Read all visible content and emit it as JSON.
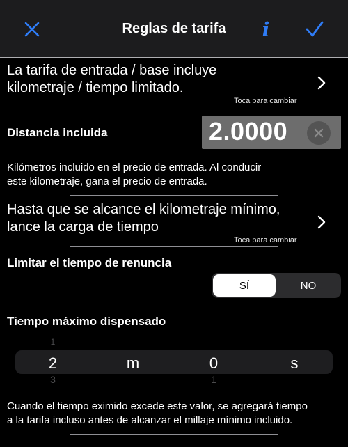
{
  "nav": {
    "title": "Reglas de tarifa",
    "close_icon": "close-icon",
    "info_icon": "info-icon",
    "info_glyph": "i",
    "done_icon": "checkmark-icon",
    "accent": "#2f7cf6"
  },
  "base_rule": {
    "text_line1": "La tarifa de entrada / base incluye",
    "text_line2": "kilometraje / tiempo limitado.",
    "hint": "Toca para cambiar"
  },
  "distance": {
    "label": "Distancia incluida",
    "value": "2.0000",
    "description_line1": "Kilómetros incluido en el precio de entrada. Al conducir",
    "description_line2": "este kilometraje, gana el precio de entrada."
  },
  "time_rule": {
    "text_line1": "Hasta que se alcance el kilometraje mínimo,",
    "text_line2": "lance la carga de tiempo",
    "hint": "Toca para cambiar"
  },
  "waiver": {
    "label": "Limitar el tiempo de renuncia",
    "options": [
      "SÍ",
      "NO"
    ],
    "selected": "SÍ"
  },
  "max_time": {
    "label": "Tiempo máximo dispensado",
    "minutes_value": "2",
    "minutes_unit": "m",
    "seconds_value": "0",
    "seconds_unit": "s",
    "minutes_above": "1",
    "minutes_below": "3",
    "seconds_below": "1",
    "description_line1": "Cuando el tiempo eximido excede este valor, se agregará tiempo",
    "description_line2": "a la tarifa incluso antes de alcanzar el millaje mínimo incluido."
  }
}
